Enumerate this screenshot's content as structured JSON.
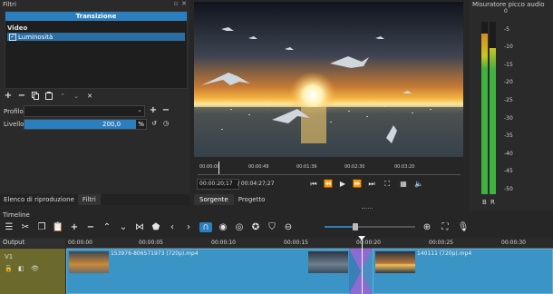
{
  "filters": {
    "title": "Filtri",
    "transition_header": "Transizione",
    "video_section": "Video",
    "items": [
      {
        "label": "Luminosità",
        "checked": true
      }
    ],
    "profile_label": "Profilo",
    "level_label": "Livello",
    "level_value": "200,0",
    "level_unit": "%",
    "level_fraction": 0.92
  },
  "left_tabs": [
    "Elenco di riproduzione",
    "Filtri"
  ],
  "player": {
    "ruler_ticks": [
      "00:00:00",
      "00:00:49",
      "00:01:39",
      "00:02:30",
      "00:03:20"
    ],
    "current_time": "00:00:20;17",
    "total_time": "/ 00:04:27;27",
    "tabs": [
      "Sorgente",
      "Progetto"
    ]
  },
  "audio_meter": {
    "title": "Misuratore picco audio",
    "scale": [
      "0",
      "-5",
      "-10",
      "-15",
      "-20",
      "-25",
      "-30",
      "-35",
      "-40",
      "-45",
      "-50"
    ],
    "channels": [
      "B",
      "R"
    ],
    "levels": [
      0.93,
      0.85
    ]
  },
  "timeline": {
    "title": "Timeline",
    "track_header": "Output",
    "track_name": "V1",
    "ruler_ticks": [
      "00:00:00",
      "00:00:05",
      "00:00:10",
      "00:00:15",
      "00:00:20",
      "00:00:25",
      "00:00:30"
    ],
    "clip1_name": "153976-806571973 (720p).mp4",
    "clip2_name": "140111 (720p).mp4"
  },
  "colors": {
    "accent": "#2b7fbf",
    "clip": "#3b94c6",
    "transition": "#8e6bd0",
    "meter_green": "#3fb23f",
    "meter_yellow": "#c9c61f"
  }
}
